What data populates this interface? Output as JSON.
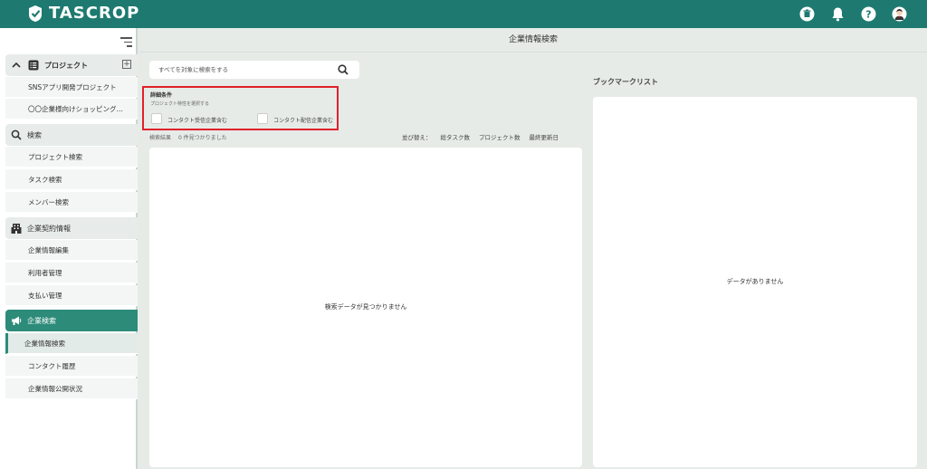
{
  "header": {
    "logo_text": "TASCROP",
    "icons": [
      "trash-icon",
      "bell-icon",
      "help-icon",
      "user-avatar-icon"
    ],
    "accent_color": "#1e7a70"
  },
  "sidebar": {
    "project_section": {
      "label": "プロジェクト",
      "add_label": "+"
    },
    "projects": [
      "SNSアプリ開発プロジェクト",
      "〇〇企業様向けショッピング…"
    ],
    "search_section": {
      "label": "検索"
    },
    "search_items": [
      "プロジェクト検索",
      "タスク検索",
      "メンバー検索"
    ],
    "contract_section": {
      "label": "企業契約情報"
    },
    "contract_items": [
      "企業情報編集",
      "利用者管理",
      "支払い管理"
    ],
    "company_section": {
      "label": "企業検索"
    },
    "company_items": [
      "企業情報検索",
      "コンタクト履歴",
      "企業情報公開状況"
    ]
  },
  "main": {
    "title": "企業情報検索",
    "search": {
      "placeholder": "すべてを対象に検索をする"
    },
    "detail": {
      "title": "詳細条件",
      "subtitle": "プロジェクト特性を選択する",
      "checkbox1": "コンタクト受信企業含む",
      "checkbox2": "コンタクト配信企業含む"
    },
    "result_label": "検索結果",
    "result_count": "0 件見つかりました",
    "sort": {
      "label": "並び替え：",
      "options": [
        "総タスク数",
        "プロジェクト数",
        "最終更新日"
      ]
    },
    "empty_message": "検索データが見つかりません"
  },
  "bookmark": {
    "title": "ブックマークリスト",
    "empty_message": "データがありません"
  }
}
